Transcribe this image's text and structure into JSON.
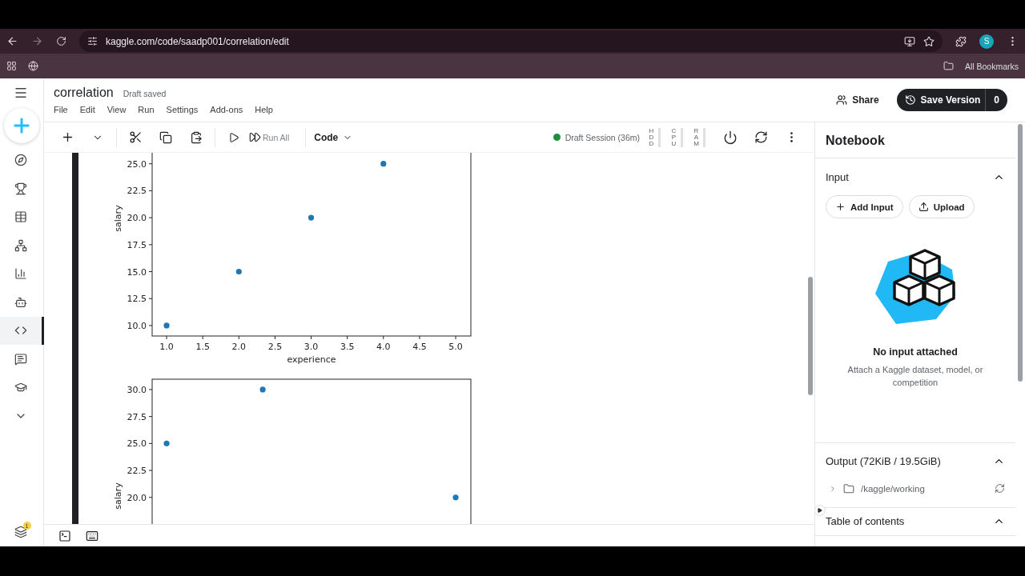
{
  "browser": {
    "url": "kaggle.com/code/saadp001/correlation/edit",
    "avatar": "S",
    "bookmarks_label": "All Bookmarks"
  },
  "sidebar": {
    "items": [
      {
        "kind": "compass",
        "selected": false
      },
      {
        "kind": "trophy",
        "selected": false
      },
      {
        "kind": "table",
        "selected": false
      },
      {
        "kind": "nodes",
        "selected": false
      },
      {
        "kind": "chart",
        "selected": false
      },
      {
        "kind": "robot",
        "selected": false
      },
      {
        "kind": "code",
        "selected": true
      },
      {
        "kind": "comment",
        "selected": false
      },
      {
        "kind": "school",
        "selected": false
      },
      {
        "kind": "more",
        "selected": false
      }
    ],
    "badge": "1"
  },
  "header": {
    "title": "correlation",
    "status": "Draft saved",
    "menu": [
      "File",
      "Edit",
      "View",
      "Run",
      "Settings",
      "Add-ons",
      "Help"
    ],
    "share": "Share",
    "save_version": "Save Version",
    "version_count": "0"
  },
  "toolbar": {
    "run_all": "Run All",
    "cell_type": "Code",
    "session": "Draft Session (36m)",
    "meters": [
      "HDD",
      "CPU",
      "RAM"
    ]
  },
  "charts": [
    {
      "chart_data": {
        "type": "scatter",
        "xlabel": "experience",
        "ylabel": "salary",
        "x": [
          1,
          2,
          3,
          4
        ],
        "series": [
          {
            "color": "#1f77b4",
            "values": [
              10,
              15,
              20,
              25
            ]
          }
        ],
        "xlim": [
          0.8,
          5.21
        ],
        "ylim": [
          9.03,
          26.5
        ],
        "xticks": [
          {
            "value": 1,
            "label": "1.0"
          },
          {
            "value": 1.5,
            "label": "1.5"
          },
          {
            "value": 2,
            "label": "2.0"
          },
          {
            "value": 2.5,
            "label": "2.5"
          },
          {
            "value": 3,
            "label": "3.0"
          },
          {
            "value": 3.5,
            "label": "3.5"
          },
          {
            "value": 4,
            "label": "4.0"
          },
          {
            "value": 4.5,
            "label": "4.5"
          },
          {
            "value": 5,
            "label": "5.0"
          }
        ],
        "yticks": [
          {
            "value": 10,
            "label": "10.0"
          },
          {
            "value": 12.5,
            "label": "12.5"
          },
          {
            "value": 15,
            "label": "15.0"
          },
          {
            "value": 17.5,
            "label": "17.5"
          },
          {
            "value": 20,
            "label": "20.0"
          },
          {
            "value": 22.5,
            "label": "22.5"
          },
          {
            "value": 25,
            "label": "25.0"
          }
        ]
      }
    },
    {
      "chart_data": {
        "type": "scatter",
        "ylabel": "salary",
        "x": [
          1,
          2.33,
          5
        ],
        "series": [
          {
            "color": "#1f77b4",
            "values": [
              25,
              30,
              20
            ]
          }
        ],
        "xlim": [
          0.8,
          5.21
        ],
        "ylim": [
          17.3,
          30.96
        ],
        "yticks": [
          {
            "value": 20,
            "label": "20.0"
          },
          {
            "value": 22.5,
            "label": "22.5"
          },
          {
            "value": 25,
            "label": "25.0"
          },
          {
            "value": 27.5,
            "label": "27.5"
          },
          {
            "value": 30,
            "label": "30.0"
          }
        ]
      }
    }
  ],
  "panel": {
    "title": "Notebook",
    "input": {
      "title": "Input",
      "expanded": true,
      "buttons": [
        {
          "kind": "add",
          "label": "Add Input"
        },
        {
          "kind": "upload",
          "label": "Upload"
        }
      ],
      "empty_title": "No input attached",
      "empty_text": "Attach a Kaggle dataset, model, or competition"
    },
    "output": {
      "title": "Output (72KiB / 19.5GiB)",
      "expanded": true,
      "folders": [
        {
          "path": "/kaggle/working",
          "expanded": false
        }
      ]
    },
    "toc": {
      "title": "Table of contents",
      "expanded": true
    }
  }
}
